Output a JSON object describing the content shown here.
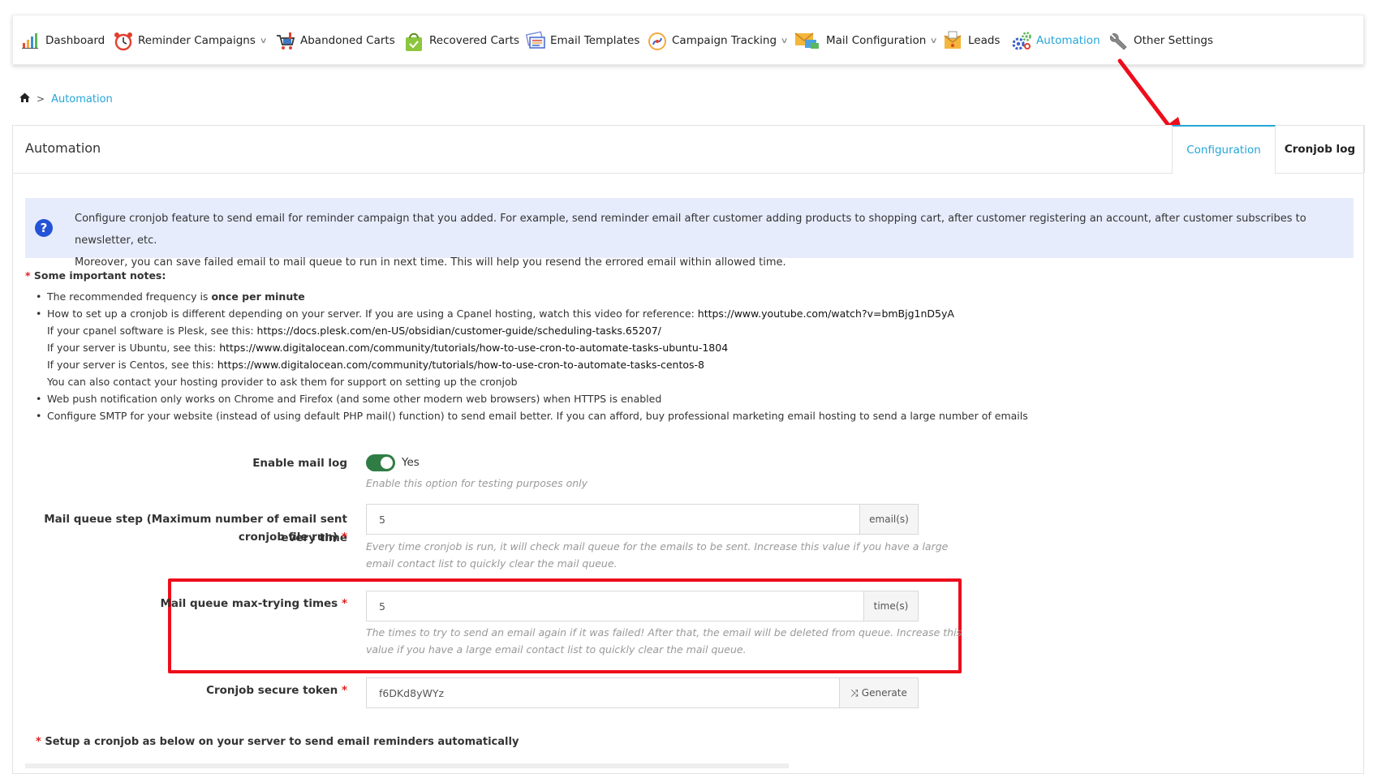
{
  "nav": {
    "items": [
      {
        "label": "Dashboard",
        "icon": "bar-chart-icon",
        "dropdown": false
      },
      {
        "label": "Reminder Campaigns",
        "icon": "alarm-clock-icon",
        "dropdown": true
      },
      {
        "label": "Abandoned Carts",
        "icon": "shopping-cart-icon",
        "dropdown": false
      },
      {
        "label": "Recovered Carts",
        "icon": "shopping-bag-icon",
        "dropdown": false
      },
      {
        "label": "Email Templates",
        "icon": "email-templates-icon",
        "dropdown": false
      },
      {
        "label": "Campaign Tracking",
        "icon": "campaign-tracking-icon",
        "dropdown": true
      },
      {
        "label": "Mail Configuration",
        "icon": "mail-configuration-icon",
        "dropdown": true
      },
      {
        "label": "Leads",
        "icon": "leads-icon",
        "dropdown": false
      },
      {
        "label": "Automation",
        "icon": "gears-icon",
        "dropdown": false,
        "active": true
      },
      {
        "label": "Other Settings",
        "icon": "wrench-icon",
        "dropdown": false
      }
    ]
  },
  "breadcrumb": {
    "separator": ">",
    "current": "Automation"
  },
  "panel": {
    "title": "Automation",
    "tabs": [
      {
        "label": "Configuration",
        "active": true
      },
      {
        "label": "Cronjob log",
        "active": false
      }
    ]
  },
  "info": {
    "line1": "Configure cronjob feature to send email for reminder campaign that you added. For example, send reminder email after customer adding products to shopping cart, after customer registering an account, after customer subscribes to newsletter, etc.",
    "line2": "Moreover, you can save failed email to mail queue to run in next time. This will help you resend the errored email within allowed time."
  },
  "notes": {
    "title": "Some important notes:",
    "freq_prefix": "The recommended frequency is ",
    "freq_bold": "once per minute",
    "cron_prefix": "How to set up a cronjob is different depending on your server. If you are using a Cpanel hosting, watch this video for reference: ",
    "cron_link": "https://www.youtube.com/watch?v=bmBjg1nD5yA",
    "plesk_prefix": "If your cpanel software is Plesk, see this: ",
    "plesk_link": "https://docs.plesk.com/en-US/obsidian/customer-guide/scheduling-tasks.65207/",
    "ubuntu_prefix": "If your server is Ubuntu, see this: ",
    "ubuntu_link": "https://www.digitalocean.com/community/tutorials/how-to-use-cron-to-automate-tasks-ubuntu-1804",
    "centos_prefix": "If your server is Centos, see this: ",
    "centos_link": "https://www.digitalocean.com/community/tutorials/how-to-use-cron-to-automate-tasks-centos-8",
    "contact": "You can also contact your hosting provider to ask them for support on setting up the cronjob",
    "webpush": "Web push notification only works on Chrome and Firefox (and some other modern web browsers) when HTTPS is enabled",
    "smtp": "Configure SMTP for your website (instead of using default PHP mail() function) to send email better. If you can afford, buy professional marketing email hosting to send a large number of emails"
  },
  "form": {
    "mail_log": {
      "label": "Enable mail log",
      "toggle_text": "Yes",
      "enabled": true,
      "help": "Enable this option for testing purposes only"
    },
    "queue_step": {
      "label_line1": "Mail queue step (Maximum number of email sent every time",
      "label_line2": "cronjob file run)",
      "value": "5",
      "addon": "email(s)",
      "help_line1": "Every time cronjob is run, it will check mail queue for the emails to be sent. Increase this value if you have a large",
      "help_line2": "email contact list to quickly clear the mail queue."
    },
    "max_trying": {
      "label": "Mail queue max-trying times",
      "value": "5",
      "addon": "time(s)",
      "help_line1": "The times to try to send an email again if it was failed! After that, the email will be deleted from queue. Increase this",
      "help_line2": "value if you have a large email contact list to quickly clear the mail queue."
    },
    "token": {
      "label": "Cronjob secure token",
      "value": "f6DKd8yWYz",
      "button": "Generate"
    }
  },
  "setup_title": "Setup a cronjob as below on your server to send email reminders automatically",
  "required_mark": "*",
  "colors": {
    "accent": "#25a6d8",
    "annotation_red": "#ee0d1b",
    "toggle_green": "#2f7d44",
    "info_bg": "#e7ecfd"
  }
}
